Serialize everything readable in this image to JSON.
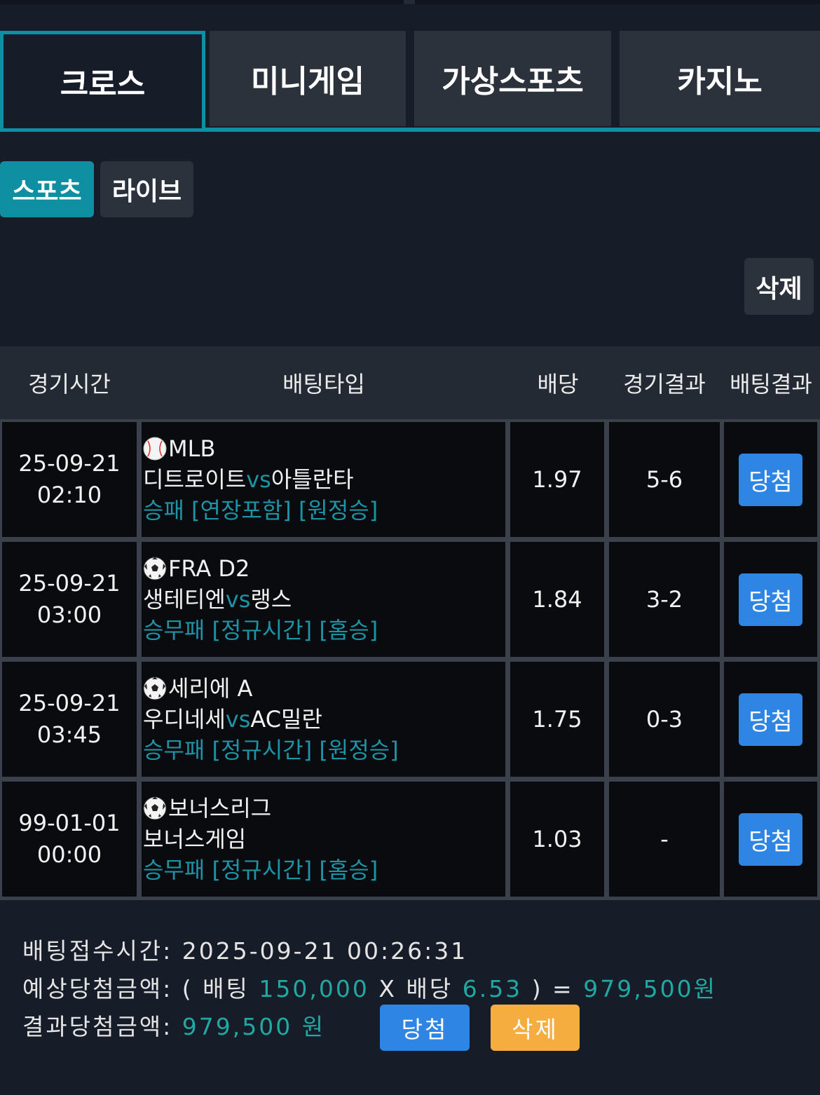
{
  "main_tabs": [
    {
      "label": "크로스",
      "active": true
    },
    {
      "label": "미니게임",
      "active": false
    },
    {
      "label": "가상스포츠",
      "active": false
    },
    {
      "label": "카지노",
      "active": false
    }
  ],
  "sub_tabs": [
    {
      "label": "스포츠",
      "active": true
    },
    {
      "label": "라이브",
      "active": false
    }
  ],
  "delete_label": "삭제",
  "table": {
    "headers": [
      "경기시간",
      "배팅타입",
      "배당",
      "경기결과",
      "배팅결과"
    ],
    "rows": [
      {
        "date": "25-09-21",
        "time": "02:10",
        "sport_icon": "baseball-icon",
        "league": "MLB",
        "home": "디트로이트",
        "vs": "vs",
        "away": "아틀란타",
        "bet": "승패 [연장포함] [원정승]",
        "odds": "1.97",
        "score": "5-6",
        "result": "당첨"
      },
      {
        "date": "25-09-21",
        "time": "03:00",
        "sport_icon": "soccer-ball-icon",
        "league": "FRA D2",
        "home": "생테티엔",
        "vs": "vs",
        "away": "랭스",
        "bet": "승무패 [정규시간] [홈승]",
        "odds": "1.84",
        "score": "3-2",
        "result": "당첨"
      },
      {
        "date": "25-09-21",
        "time": "03:45",
        "sport_icon": "soccer-ball-icon",
        "league": "세리에 A",
        "home": "우디네세",
        "vs": "vs",
        "away": "AC밀란",
        "bet": "승무패 [정규시간] [원정승]",
        "odds": "1.75",
        "score": "0-3",
        "result": "당첨"
      },
      {
        "date": "99-01-01",
        "time": "00:00",
        "sport_icon": "soccer-ball-icon",
        "league": "보너스리그",
        "home": "보너스게임",
        "vs": "",
        "away": "",
        "bet": "승무패 [정규시간] [홈승]",
        "odds": "1.03",
        "score": "-",
        "result": "당첨"
      }
    ]
  },
  "summary": {
    "received_label": "배팅접수시간:",
    "received_value": "2025-09-21 00:26:31",
    "expected_label": "예상당첨금액:",
    "open_paren": "(",
    "bet_word": "배팅",
    "bet_amount": "150,000",
    "times": "X",
    "odds_word": "배당",
    "total_odds": "6.53",
    "close_eq": ") =",
    "expected_amount": "979,500원",
    "result_label": "결과당첨금액:",
    "result_amount": "979,500 원",
    "win_button": "당첨",
    "delete_button": "삭제"
  },
  "colors": {
    "accent": "#0f8fa2",
    "win_button": "#2f85e4",
    "delete_button": "#f5ad3f",
    "amount_teal": "#22a8a3"
  }
}
